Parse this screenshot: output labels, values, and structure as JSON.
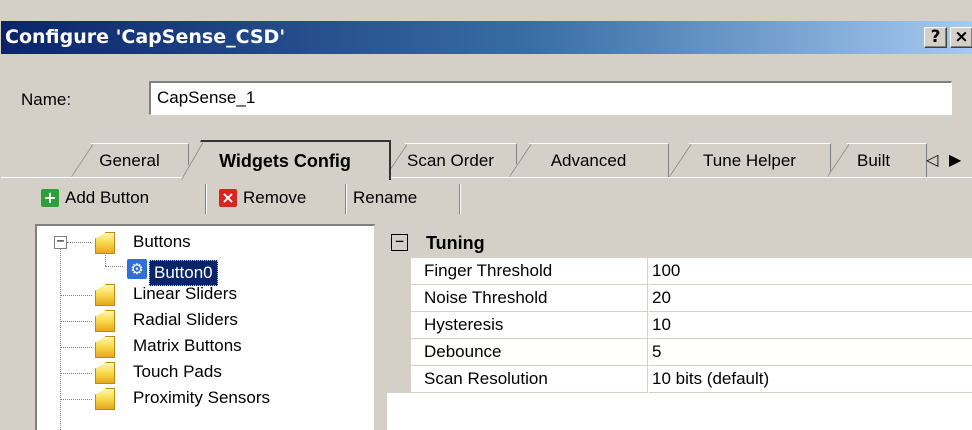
{
  "window": {
    "title": "Configure 'CapSense_CSD'",
    "help_label": "?",
    "close_label": "×"
  },
  "name_row": {
    "label": "Name:",
    "value": "CapSense_1"
  },
  "tabs": [
    {
      "label": "General"
    },
    {
      "label": "Widgets Config"
    },
    {
      "label": "Scan Order"
    },
    {
      "label": "Advanced"
    },
    {
      "label": "Tune Helper"
    },
    {
      "label": "Built"
    }
  ],
  "tab_scroll": {
    "left": "◁",
    "right": "▶"
  },
  "toolbar": {
    "add_label": "Add Button",
    "add_icon": "+",
    "remove_label": "Remove",
    "remove_icon": "×",
    "rename_label": "Rename"
  },
  "tree": {
    "root_expander": "−",
    "items": [
      {
        "label": "Buttons"
      },
      {
        "label": "Button0"
      },
      {
        "label": "Linear Sliders"
      },
      {
        "label": "Radial Sliders"
      },
      {
        "label": "Matrix Buttons"
      },
      {
        "label": "Touch Pads"
      },
      {
        "label": "Proximity Sensors"
      }
    ]
  },
  "grid": {
    "category": "Tuning",
    "collapse_glyph": "−",
    "rows": [
      {
        "name": "Finger Threshold",
        "value": "100"
      },
      {
        "name": "Noise Threshold",
        "value": "20"
      },
      {
        "name": "Hysteresis",
        "value": "10"
      },
      {
        "name": "Debounce",
        "value": "5"
      },
      {
        "name": "Scan Resolution",
        "value": "10 bits (default)"
      }
    ]
  },
  "colors": {
    "titlebar_start": "#0a246a",
    "titlebar_end": "#a6caf0",
    "selection": "#0a246a",
    "dialog_face": "#d4d0c8"
  }
}
